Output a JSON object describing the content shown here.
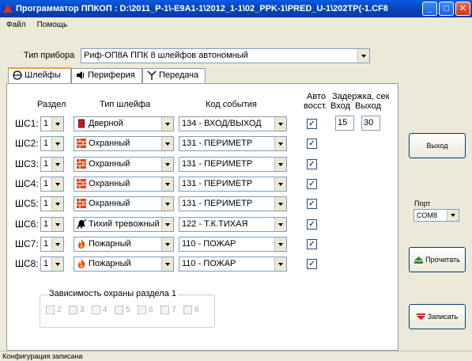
{
  "window": {
    "title": "Программатор ППКОП : D:\\2011_P-1\\-E9A1-1\\2012_1-1\\02_PPK-1\\PRED_U-1\\202TP(-1.CF8"
  },
  "menu": {
    "items": [
      "Файл",
      "Помощь"
    ]
  },
  "device": {
    "label": "Тип прибора",
    "value": "Риф-ОП8А ППК 8 шлейфов автономный"
  },
  "tabs": [
    {
      "label": "Шлейфы",
      "icon": "loop-icon",
      "active": true
    },
    {
      "label": "Периферия",
      "icon": "speaker-icon",
      "active": false
    },
    {
      "label": "Передача",
      "icon": "antenna-icon",
      "active": false
    }
  ],
  "headers": {
    "section": "Раздел",
    "loop_type": "Тип шлейфа",
    "event_code": "Код события",
    "auto_line1": "Авто",
    "auto_line2": "восст.",
    "delay": "Задержка, сек",
    "delay_in": "Вход",
    "delay_out": "Выход"
  },
  "loops": [
    {
      "name": "ШС1:",
      "section": "1",
      "type": "Дверной",
      "type_icon": "door-icon",
      "code": "134 - ВХОД/ВЫХОД",
      "auto": true,
      "delay_in": "15",
      "delay_out": "30"
    },
    {
      "name": "ШС2:",
      "section": "1",
      "type": "Охранный",
      "type_icon": "brick-wall-icon",
      "code": "131 - ПЕРИМЕТР",
      "auto": true
    },
    {
      "name": "ШС3:",
      "section": "1",
      "type": "Охранный",
      "type_icon": "brick-wall-icon",
      "code": "131 - ПЕРИМЕТР",
      "auto": true
    },
    {
      "name": "ШС4:",
      "section": "1",
      "type": "Охранный",
      "type_icon": "brick-wall-icon",
      "code": "131 - ПЕРИМЕТР",
      "auto": true
    },
    {
      "name": "ШС5:",
      "section": "1",
      "type": "Охранный",
      "type_icon": "brick-wall-icon",
      "code": "131 - ПЕРИМЕТР",
      "auto": true
    },
    {
      "name": "ШС6:",
      "section": "1",
      "type": "Тихий тревожный",
      "type_icon": "alarm-bell-icon",
      "code": "122 - Т.К.ТИХАЯ",
      "auto": true
    },
    {
      "name": "ШС7:",
      "section": "1",
      "type": "Пожарный",
      "type_icon": "fire-icon",
      "code": "110 - ПОЖАР",
      "auto": true
    },
    {
      "name": "ШС8:",
      "section": "1",
      "type": "Пожарный",
      "type_icon": "fire-icon",
      "code": "110 - ПОЖАР",
      "auto": true
    }
  ],
  "dependency": {
    "title": "Зависимость охраны раздела 1",
    "items": [
      "2",
      "3",
      "4",
      "5",
      "6",
      "7",
      "8"
    ]
  },
  "right": {
    "exit_label": "Выход",
    "port_label": "Порт",
    "port_value": "COM8",
    "read_label": "Прочитать",
    "write_label": "Записать"
  },
  "status": "Конфигурация записана",
  "colors": {
    "title_bar": "#0842b8",
    "panel": "#ffffff",
    "window_bg": "#ece9d8"
  }
}
